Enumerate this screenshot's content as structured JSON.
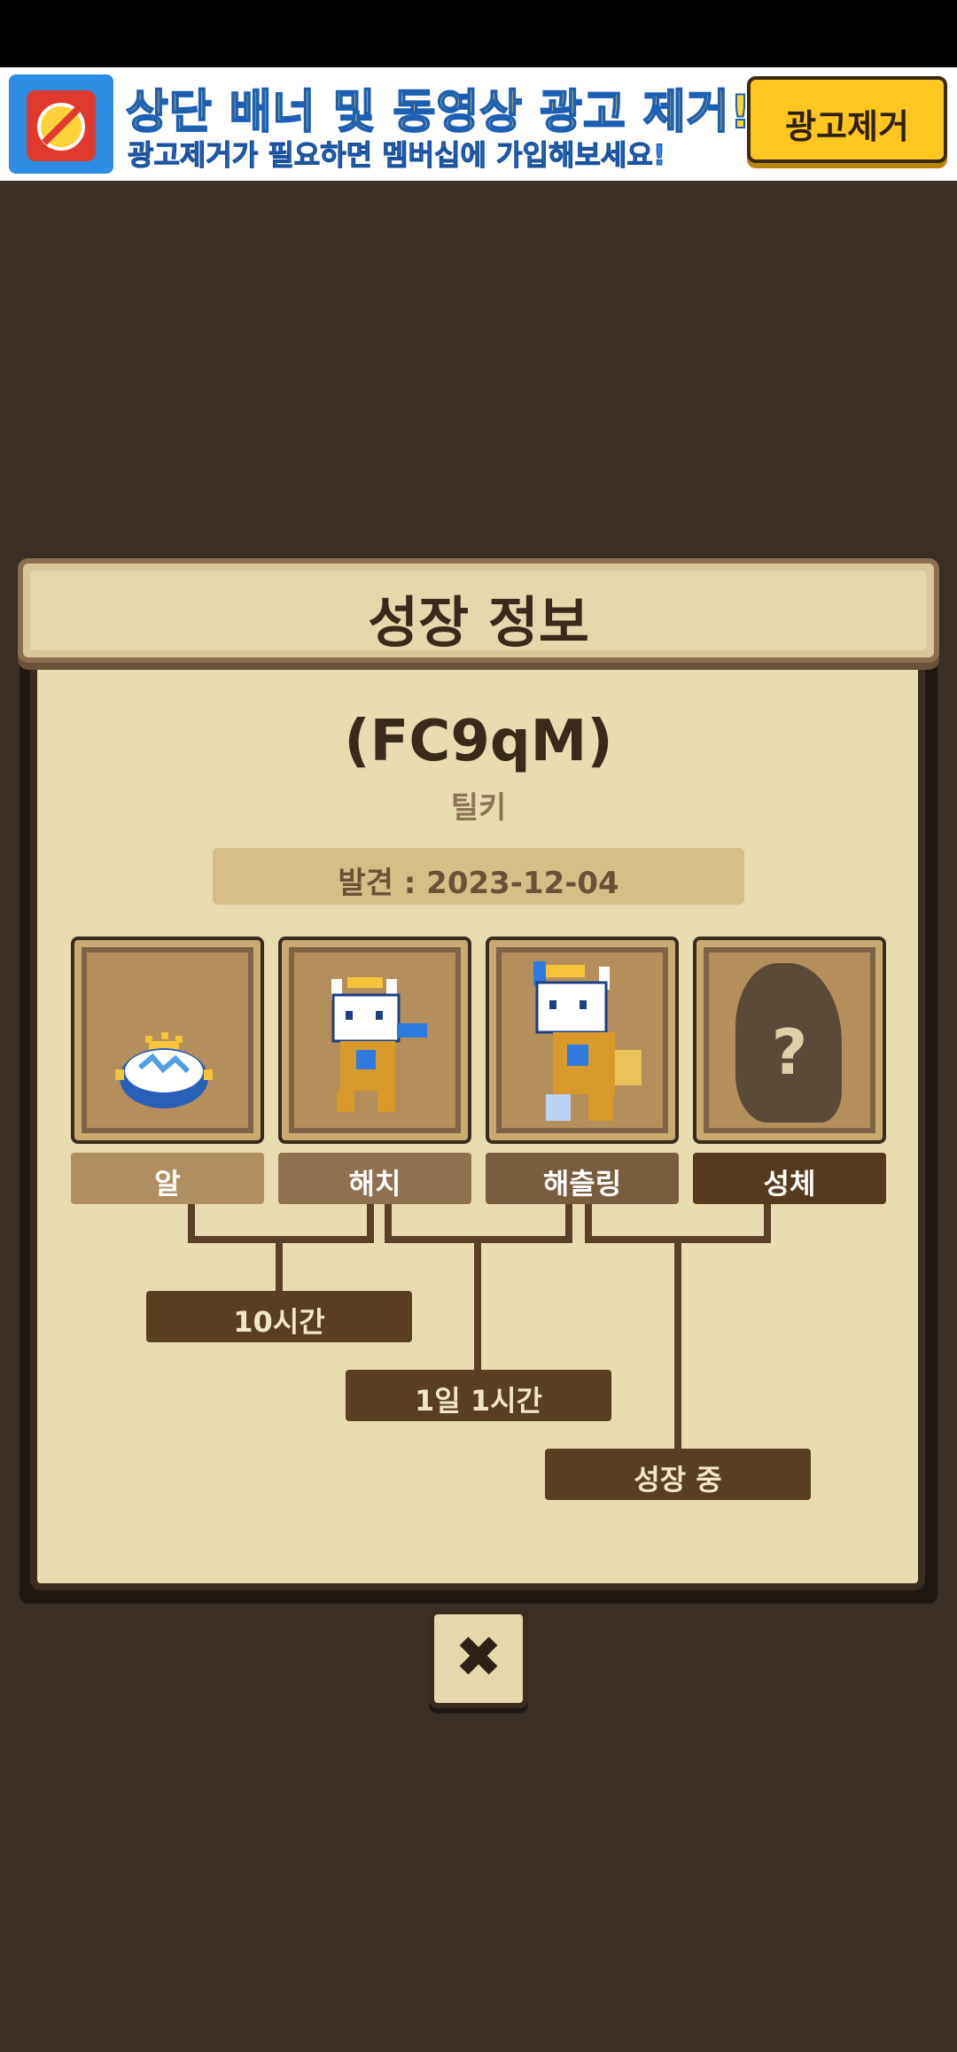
{
  "ad": {
    "title": "상단 배너 및 동영상 광고 제거!",
    "subtitle": "광고제거가 필요하면 멤버십에 가입해보세요!",
    "button": "광고제거",
    "icon": "no-ads-clock-icon"
  },
  "panel": {
    "title": "성장 정보",
    "pet_id": "(FC9qM)",
    "species": "틸키",
    "found": "발견 : 2023-12-04"
  },
  "stages": [
    {
      "label": "알",
      "image": "egg-sprite",
      "color": "#b08f62"
    },
    {
      "label": "해치",
      "image": "hatchling-cat-sprite",
      "color": "#8f7152"
    },
    {
      "label": "해츨링",
      "image": "young-cat-sprite",
      "color": "#7a5d3e"
    },
    {
      "label": "성체",
      "image": "locked-silhouette",
      "mystery": "?",
      "color": "#57391d"
    }
  ],
  "durations": [
    "10시간",
    "1일 1시간",
    "성장 중"
  ],
  "close_icon": "✖"
}
